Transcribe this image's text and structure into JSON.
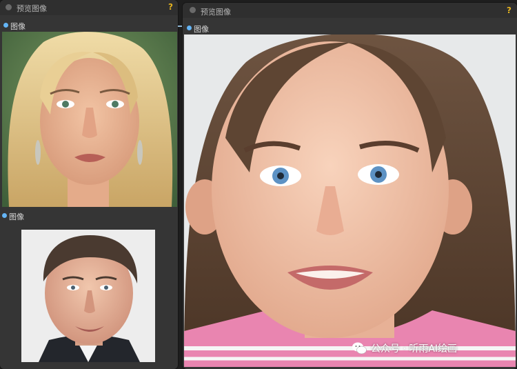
{
  "left_node": {
    "title": "预览图像",
    "help": "?",
    "outputs": [
      "图像",
      "图像"
    ],
    "photos": [
      "blonde-woman-portrait",
      "man-portrait"
    ]
  },
  "right_node": {
    "title": "预览图像",
    "help": "?",
    "outputs": [
      "图像"
    ],
    "photo": "girl-portrait"
  },
  "watermark": {
    "icon": "wechat-icon",
    "text": "公众号 · 听雨AI绘画"
  },
  "colors": {
    "node_body": "#353535",
    "node_header": "#2f2f2f",
    "slot_dot": "#64b5f6",
    "help": "#e3b220"
  }
}
